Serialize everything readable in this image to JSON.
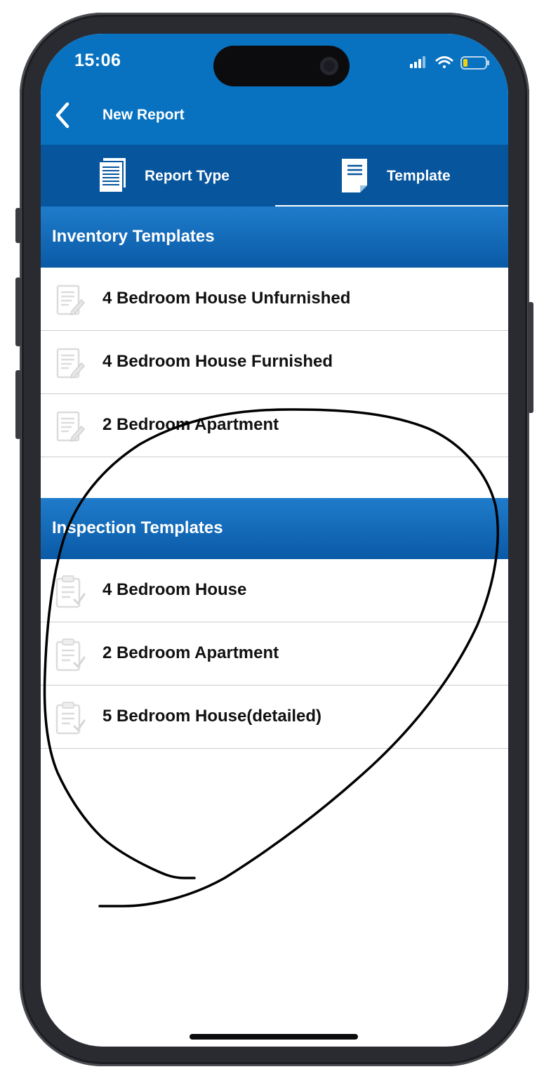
{
  "status_bar": {
    "time": "15:06",
    "icons": [
      "signal-icon",
      "wifi-icon",
      "battery-icon"
    ],
    "battery_level": 0.2
  },
  "nav": {
    "back_icon": "chevron-left-icon",
    "title": "New Report"
  },
  "tabs": [
    {
      "label": "Report Type",
      "icon": "documents-icon",
      "selected": false
    },
    {
      "label": "Template",
      "icon": "document-icon",
      "selected": true
    }
  ],
  "sections": [
    {
      "title": "Inventory Templates",
      "item_icon": "pencil-document-icon",
      "items": [
        {
          "label": "4 Bedroom House Unfurnished"
        },
        {
          "label": "4 Bedroom House Furnished"
        },
        {
          "label": "2 Bedroom Apartment"
        }
      ]
    },
    {
      "title": "Inspection Templates",
      "item_icon": "clipboard-check-icon",
      "items": [
        {
          "label": "4 Bedroom House"
        },
        {
          "label": "2 Bedroom Apartment"
        },
        {
          "label": "5 Bedroom House(detailed)"
        }
      ]
    }
  ],
  "colors": {
    "primary": "#0872c0",
    "tab_bar": "#06559d",
    "header_top": "#1f7ccb",
    "header_bottom": "#0a5aa6",
    "battery_fill": "#f2d20b"
  }
}
